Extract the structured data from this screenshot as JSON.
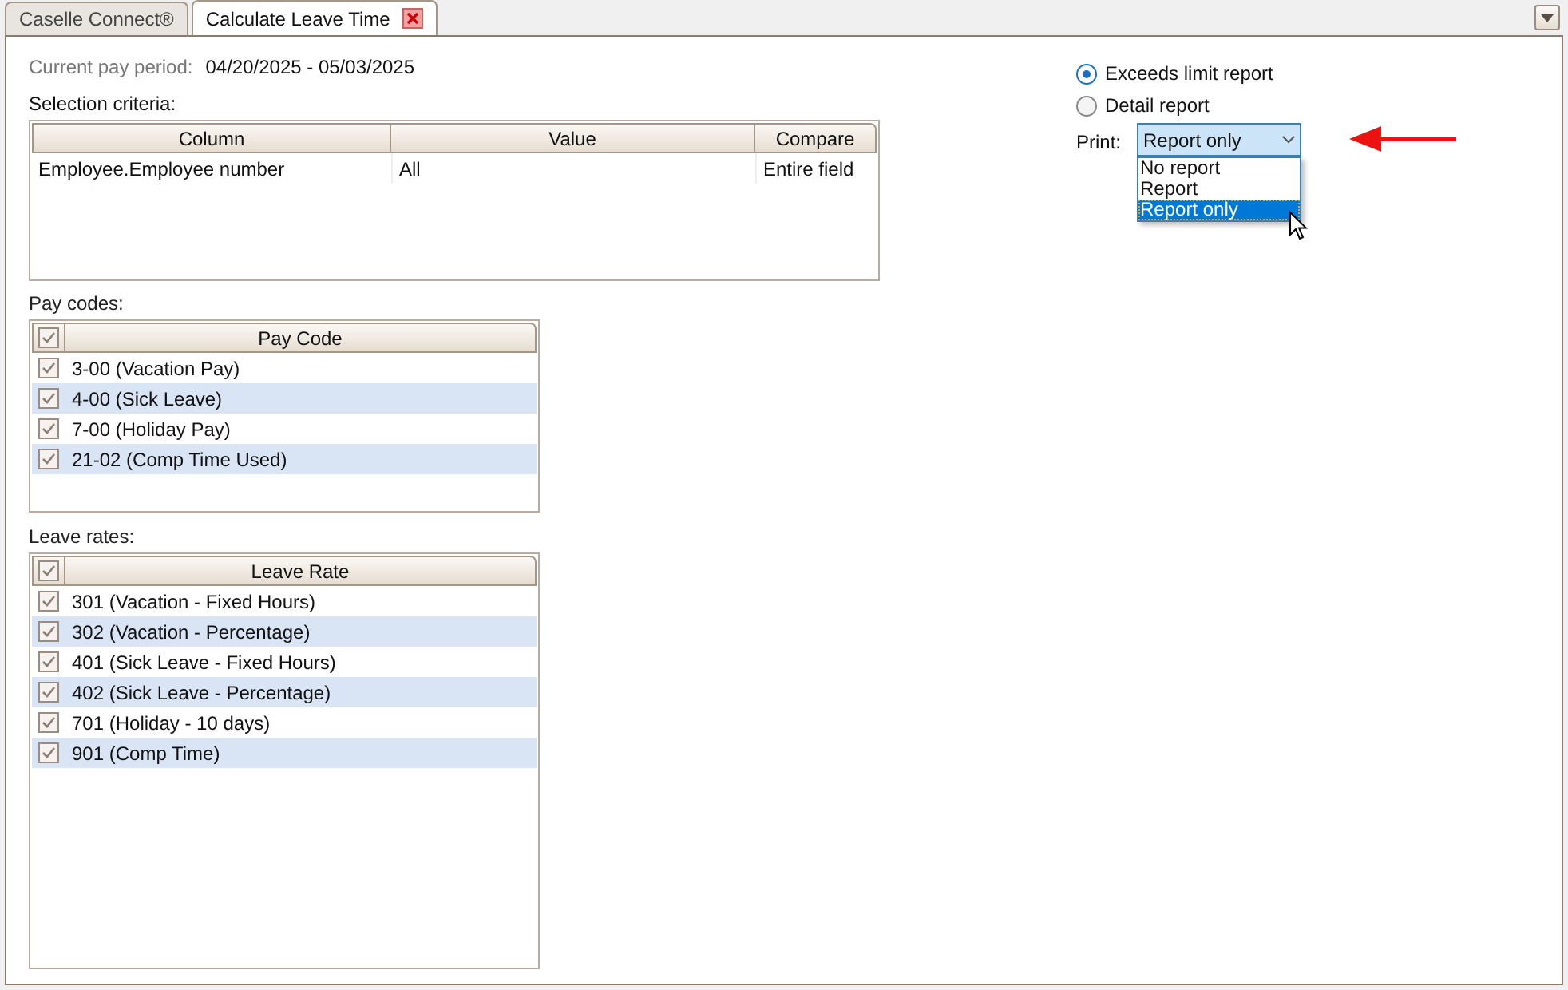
{
  "tabs": [
    {
      "label": "Caselle Connect®",
      "selected": false,
      "closable": false
    },
    {
      "label": "Calculate Leave Time",
      "selected": true,
      "closable": true
    }
  ],
  "pay_period": {
    "label": "Current pay period:",
    "value": "04/20/2025 - 05/03/2025"
  },
  "selection_criteria": {
    "label": "Selection criteria:",
    "columns": [
      "Column",
      "Value",
      "Compare"
    ],
    "rows": [
      [
        "Employee.Employee number",
        "All",
        "Entire field"
      ]
    ]
  },
  "pay_codes": {
    "label": "Pay codes:",
    "column": "Pay Code",
    "header_checked": true,
    "rows": [
      {
        "label": "3-00 (Vacation Pay)",
        "checked": true
      },
      {
        "label": "4-00 (Sick Leave)",
        "checked": true
      },
      {
        "label": "7-00 (Holiday Pay)",
        "checked": true
      },
      {
        "label": "21-02 (Comp Time Used)",
        "checked": true
      }
    ]
  },
  "leave_rates": {
    "label": "Leave rates:",
    "column": "Leave Rate",
    "header_checked": true,
    "rows": [
      {
        "label": "301 (Vacation - Fixed Hours)",
        "checked": true
      },
      {
        "label": "302 (Vacation - Percentage)",
        "checked": true
      },
      {
        "label": "401 (Sick Leave - Fixed Hours)",
        "checked": true
      },
      {
        "label": "402 (Sick Leave - Percentage)",
        "checked": true
      },
      {
        "label": "701 (Holiday - 10 days)",
        "checked": true
      },
      {
        "label": "901 (Comp Time)",
        "checked": true
      }
    ]
  },
  "report_type": [
    {
      "label": "Exceeds limit report",
      "selected": true
    },
    {
      "label": "Detail report",
      "selected": false
    }
  ],
  "print": {
    "label": "Print:",
    "value": "Report only",
    "options": [
      {
        "label": "No report",
        "selected": false
      },
      {
        "label": "Report",
        "selected": false
      },
      {
        "label": "Report only",
        "selected": true
      }
    ]
  }
}
